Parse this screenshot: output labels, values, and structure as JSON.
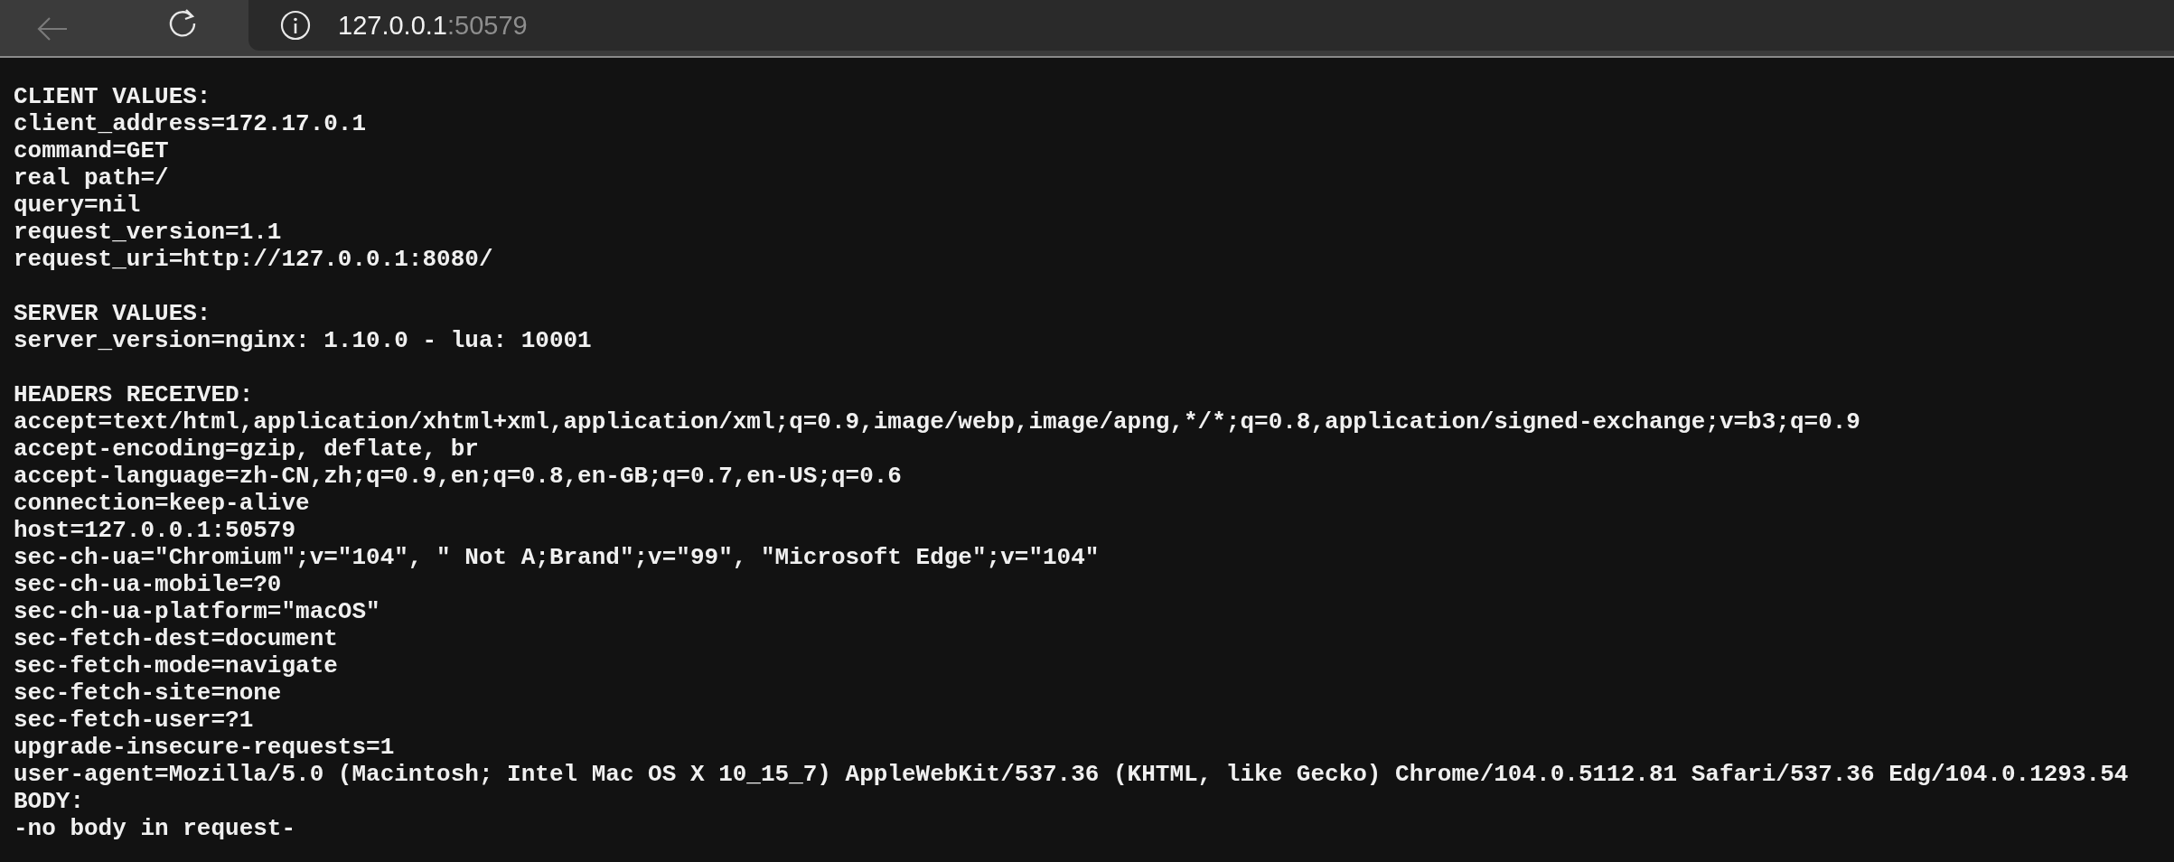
{
  "toolbar": {
    "address": {
      "host": "127.0.0.1",
      "port": ":50579"
    }
  },
  "sections": [
    {
      "heading": "CLIENT VALUES:",
      "lines": [
        "client_address=172.17.0.1",
        "command=GET",
        "real path=/",
        "query=nil",
        "request_version=1.1",
        "request_uri=http://127.0.0.1:8080/"
      ]
    },
    {
      "heading": "SERVER VALUES:",
      "lines": [
        "server_version=nginx: 1.10.0 - lua: 10001"
      ]
    },
    {
      "heading": "HEADERS RECEIVED:",
      "lines": [
        "accept=text/html,application/xhtml+xml,application/xml;q=0.9,image/webp,image/apng,*/*;q=0.8,application/signed-exchange;v=b3;q=0.9",
        "accept-encoding=gzip, deflate, br",
        "accept-language=zh-CN,zh;q=0.9,en;q=0.8,en-GB;q=0.7,en-US;q=0.6",
        "connection=keep-alive",
        "host=127.0.0.1:50579",
        "sec-ch-ua=\"Chromium\";v=\"104\", \" Not A;Brand\";v=\"99\", \"Microsoft Edge\";v=\"104\"",
        "sec-ch-ua-mobile=?0",
        "sec-ch-ua-platform=\"macOS\"",
        "sec-fetch-dest=document",
        "sec-fetch-mode=navigate",
        "sec-fetch-site=none",
        "sec-fetch-user=?1",
        "upgrade-insecure-requests=1",
        "user-agent=Mozilla/5.0 (Macintosh; Intel Mac OS X 10_15_7) AppleWebKit/537.36 (KHTML, like Gecko) Chrome/104.0.5112.81 Safari/537.36 Edg/104.0.1293.54"
      ]
    },
    {
      "heading": "BODY:",
      "lines": [
        "-no body in request-"
      ]
    }
  ]
}
